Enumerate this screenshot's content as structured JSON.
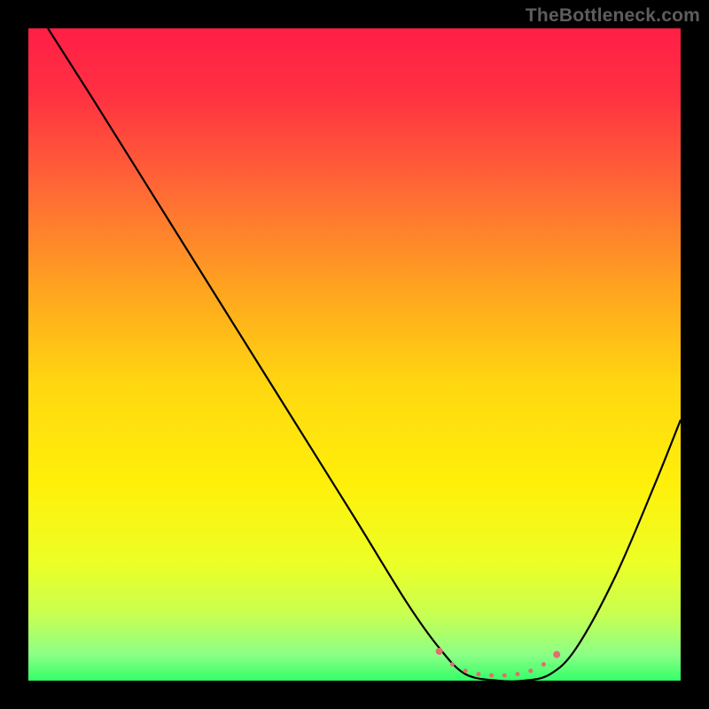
{
  "watermark": "TheBottleneck.com",
  "chart_data": {
    "type": "line",
    "title": "",
    "xlabel": "",
    "ylabel": "",
    "xlim": [
      0,
      100
    ],
    "ylim": [
      0,
      100
    ],
    "grid": false,
    "legend": false,
    "background_gradient": {
      "stops": [
        {
          "offset": 0.0,
          "color": "#ff1f46"
        },
        {
          "offset": 0.1,
          "color": "#ff3042"
        },
        {
          "offset": 0.25,
          "color": "#ff6a35"
        },
        {
          "offset": 0.4,
          "color": "#ffa41f"
        },
        {
          "offset": 0.55,
          "color": "#ffd810"
        },
        {
          "offset": 0.7,
          "color": "#fff00a"
        },
        {
          "offset": 0.82,
          "color": "#ecff26"
        },
        {
          "offset": 0.9,
          "color": "#c7ff52"
        },
        {
          "offset": 0.96,
          "color": "#8cff86"
        },
        {
          "offset": 1.0,
          "color": "#33ff69"
        }
      ]
    },
    "series": [
      {
        "name": "bottleneck-curve",
        "color": "#000000",
        "x": [
          3,
          10,
          20,
          30,
          40,
          50,
          58,
          63,
          67,
          72,
          76,
          80,
          84,
          90,
          96,
          100
        ],
        "y": [
          100,
          89,
          73,
          57,
          41,
          25,
          12,
          5,
          1,
          0,
          0,
          1,
          5,
          16,
          30,
          40
        ]
      }
    ],
    "markers": {
      "name": "optimal-range",
      "color": "#e06e6e",
      "radius_main": 4,
      "radius_small": 2.5,
      "points": [
        {
          "x": 63,
          "y": 4.5,
          "r": "main"
        },
        {
          "x": 65,
          "y": 2.5,
          "r": "small"
        },
        {
          "x": 67,
          "y": 1.5,
          "r": "small"
        },
        {
          "x": 69,
          "y": 1.0,
          "r": "small"
        },
        {
          "x": 71,
          "y": 0.8,
          "r": "small"
        },
        {
          "x": 73,
          "y": 0.8,
          "r": "small"
        },
        {
          "x": 75,
          "y": 1.0,
          "r": "small"
        },
        {
          "x": 77,
          "y": 1.5,
          "r": "small"
        },
        {
          "x": 79,
          "y": 2.5,
          "r": "small"
        },
        {
          "x": 81,
          "y": 4.0,
          "r": "main"
        }
      ]
    }
  }
}
